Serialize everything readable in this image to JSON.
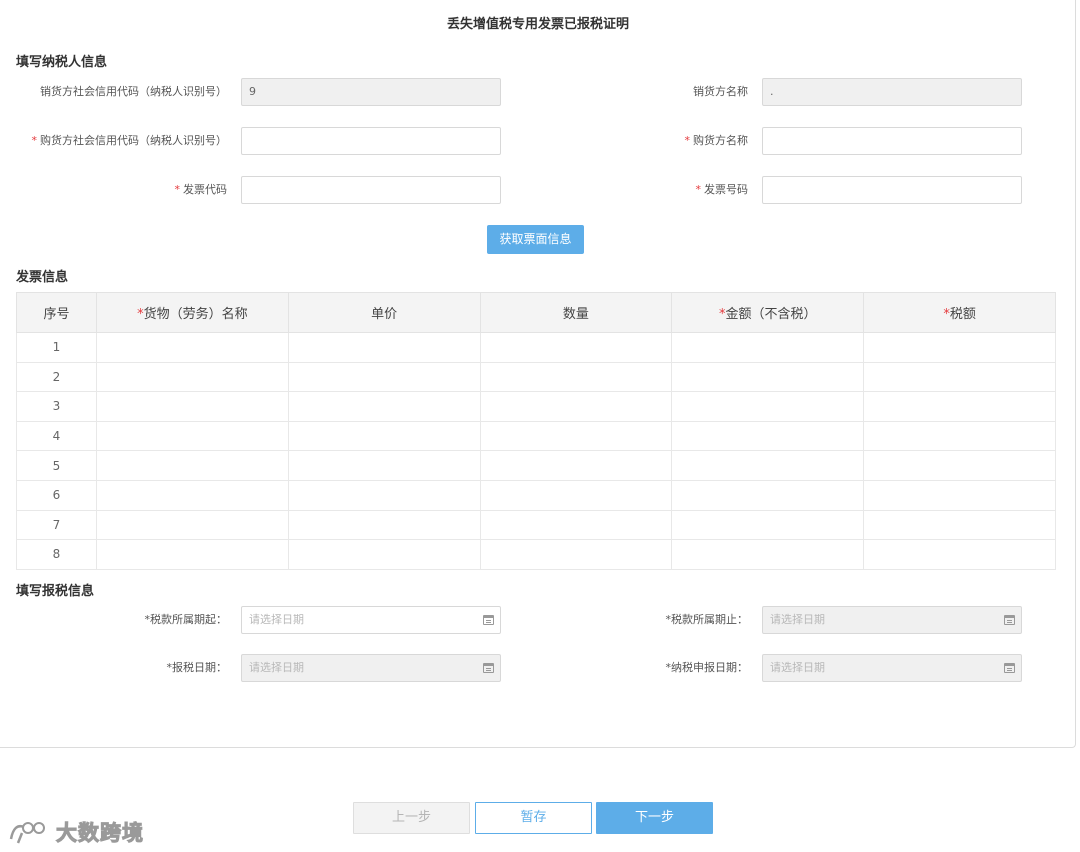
{
  "page": {
    "title": "丢失增值税专用发票已报税证明"
  },
  "sections": {
    "taxpayer": "填写纳税人信息",
    "invoice": "发票信息",
    "tax_report": "填写报税信息"
  },
  "taxpayer_fields": {
    "seller_code_label": "销货方社会信用代码（纳税人识别号）",
    "seller_code_value": "9",
    "seller_name_label": "销货方名称",
    "seller_name_value": ".",
    "buyer_code_label": "购货方社会信用代码（纳税人识别号）",
    "buyer_code_value": "",
    "buyer_name_label": "购货方名称",
    "buyer_name_value": "",
    "invoice_code_label": "发票代码",
    "invoice_code_value": "",
    "invoice_number_label": "发票号码",
    "invoice_number_value": "",
    "required_mark": "*"
  },
  "fetch_button": "获取票面信息",
  "invoice_table": {
    "columns": [
      "序号",
      "货物（劳务）名称",
      "单价",
      "数量",
      "金额（不含税）",
      "税额"
    ],
    "required_columns": [
      false,
      true,
      false,
      false,
      true,
      true
    ],
    "rows": [
      "1",
      "2",
      "3",
      "4",
      "5",
      "6",
      "7",
      "8"
    ]
  },
  "tax_fields": {
    "period_start_label": "*税款所属期起：",
    "period_start_placeholder": "请选择日期",
    "period_end_label": "*税款所属期止：",
    "period_end_placeholder": "请选择日期",
    "report_date_label": "*报税日期：",
    "report_date_placeholder": "请选择日期",
    "declare_date_label": "*纳税申报日期：",
    "declare_date_placeholder": "请选择日期"
  },
  "footer": {
    "prev": "上一步",
    "save": "暂存",
    "next": "下一步"
  },
  "watermark": {
    "text": "大数跨境"
  },
  "colors": {
    "accent": "#5dade8",
    "required": "#e4393c"
  }
}
